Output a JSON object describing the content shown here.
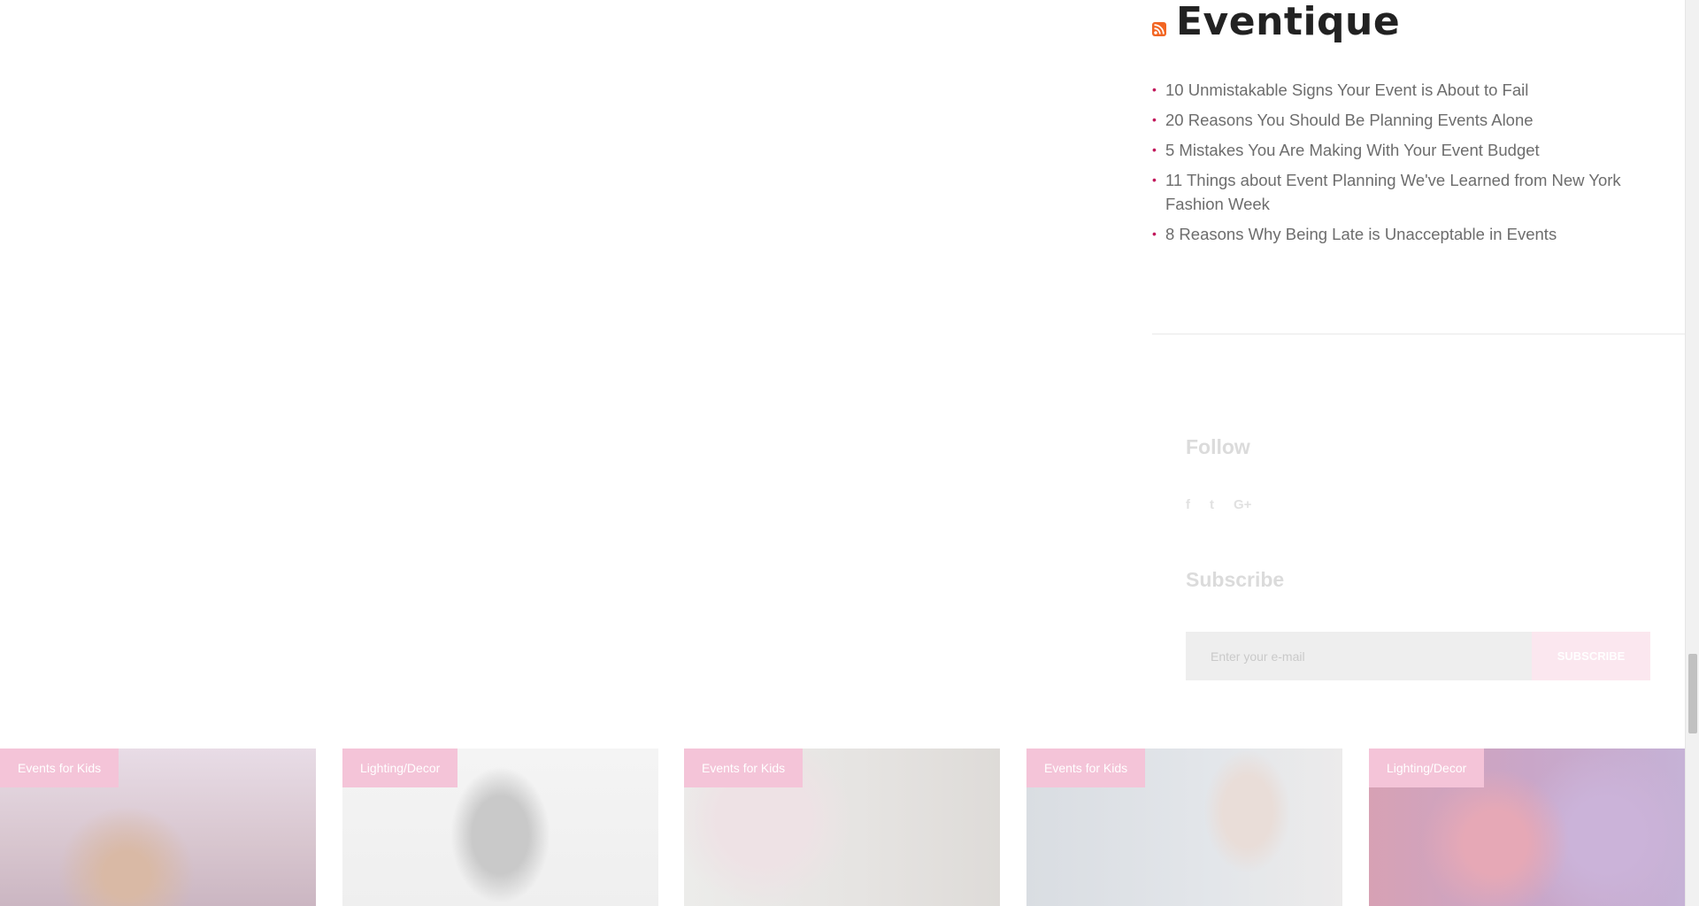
{
  "rss": {
    "icon": "rss-icon",
    "title": "Eventique",
    "items": [
      "10 Unmistakable Signs Your Event is About to Fail",
      "20 Reasons You Should Be Planning Events Alone",
      "5 Mistakes You Are Making With Your Event Budget",
      "11 Things about Event Planning We've Learned from New York Fashion Week",
      "8 Reasons Why Being Late is Unacceptable in Events"
    ],
    "bullet": "•"
  },
  "follow": {
    "title": "Follow",
    "icons": [
      "facebook-icon",
      "twitter-icon",
      "google-plus-icon"
    ],
    "glyphs": [
      "f",
      "t",
      "G+"
    ]
  },
  "subscribe": {
    "title": "Subscribe",
    "placeholder": "Enter your e-mail",
    "button_label": "SUBSCRIBE"
  },
  "gallery": [
    {
      "tag": "Events for Kids"
    },
    {
      "tag": "Lighting/Decor"
    },
    {
      "tag": "Events for Kids"
    },
    {
      "tag": "Events for Kids"
    },
    {
      "tag": "Lighting/Decor"
    }
  ],
  "colors": {
    "accent": "#c2185b",
    "tag_bg": "#f4c4d8"
  }
}
